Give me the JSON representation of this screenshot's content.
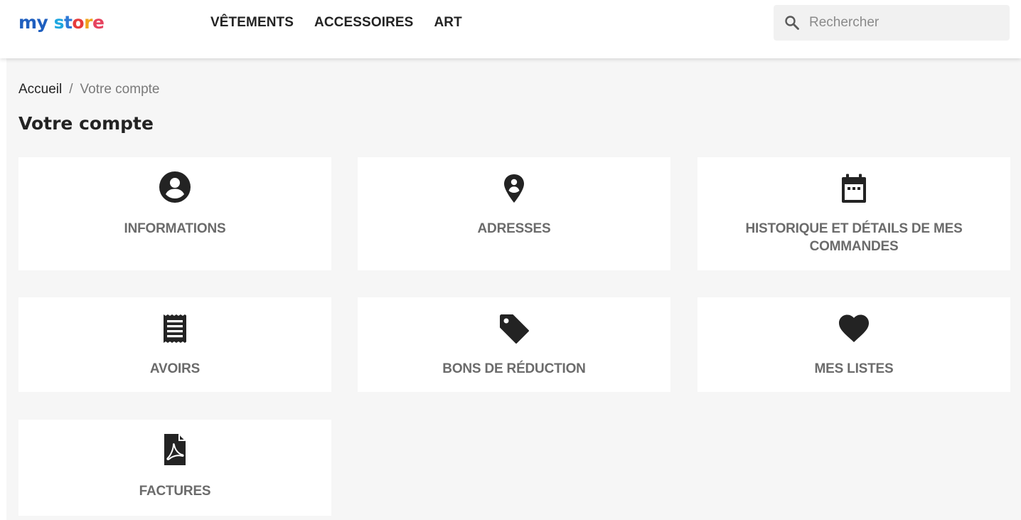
{
  "header": {
    "logo_parts": [
      "my",
      " ",
      "s",
      "t",
      "o",
      "r",
      "e"
    ],
    "nav": [
      "VÊTEMENTS",
      "ACCESSOIRES",
      "ART"
    ],
    "search": {
      "placeholder": "Rechercher",
      "value": "",
      "icon": "search-icon"
    }
  },
  "breadcrumb": {
    "home": "Accueil",
    "separator": "/",
    "current": "Votre compte"
  },
  "page_title": "Votre compte",
  "cards": [
    {
      "label": "INFORMATIONS",
      "icon": "account-circle-icon"
    },
    {
      "label": "ADRESSES",
      "icon": "location-pin-icon"
    },
    {
      "label": "HISTORIQUE ET DÉTAILS DE MES COMMANDES",
      "icon": "calendar-icon"
    },
    {
      "label": "AVOIRS",
      "icon": "receipt-icon"
    },
    {
      "label": "BONS DE RÉDUCTION",
      "icon": "tag-icon"
    },
    {
      "label": "MES LISTES",
      "icon": "heart-icon"
    },
    {
      "label": "FACTURES",
      "icon": "pdf-file-icon"
    }
  ],
  "colors": {
    "background": "#f6f6f6",
    "card": "#ffffff",
    "icon": "#232323",
    "card_label": "#6b6b6b",
    "text": "#232323",
    "logo": [
      "#1f5fbf",
      "#1fa7e0",
      "#2d78d6",
      "#e63c3c",
      "#f0a21c",
      "#7b3fb6",
      "#e6435f"
    ]
  }
}
